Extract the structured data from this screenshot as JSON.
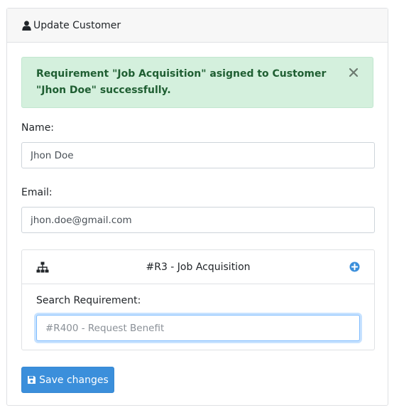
{
  "card": {
    "title": "Update Customer",
    "title_icon": "user-icon"
  },
  "alert": {
    "message": "Requirement \"Job Acquisition\" asigned to Customer \"Jhon Doe\" successfully.",
    "close_icon": "close-icon",
    "colors": {
      "background": "#d4f0dd",
      "text": "#1f5e32"
    }
  },
  "form": {
    "name_label": "Name:",
    "name_value": "Jhon Doe",
    "email_label": "Email:",
    "email_value": "jhon.doe@gmail.com"
  },
  "requirement": {
    "header_icon": "sitemap-icon",
    "header_title": "#R3 - Job Acquisition",
    "add_icon": "plus-circle-icon",
    "search_label": "Search Requirement:",
    "search_placeholder": "#R400 - Request Benefit"
  },
  "actions": {
    "save_label": "Save changes",
    "save_icon": "floppy-disk-icon",
    "accent_color": "#3b8fdb"
  }
}
